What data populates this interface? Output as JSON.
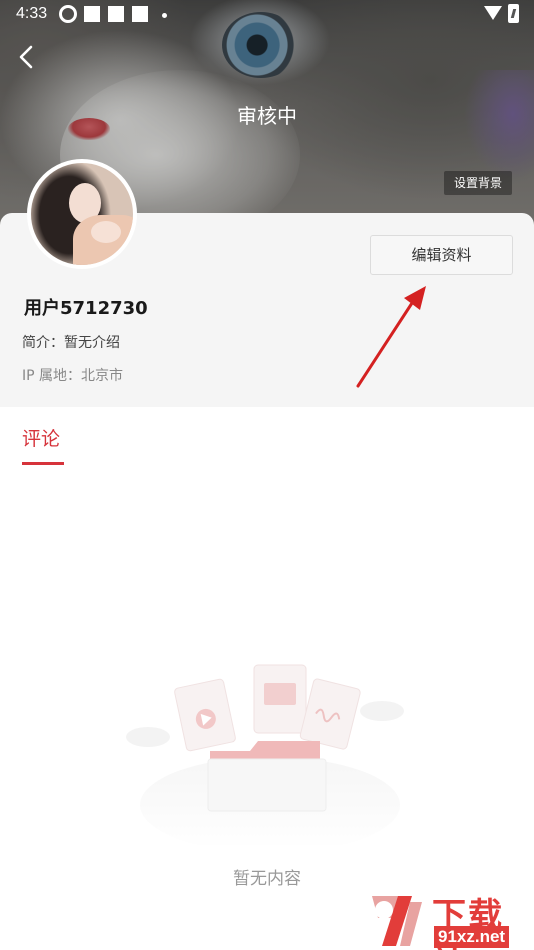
{
  "status_bar": {
    "time": "4:33"
  },
  "header": {
    "title": "审核中",
    "set_background_label": "设置背景",
    "icons": {
      "back": "back-chevron-icon"
    }
  },
  "profile": {
    "username": "用户5712730",
    "bio": "简介：暂无介绍",
    "ip_location": "IP 属地：北京市",
    "edit_button_label": "编辑资料"
  },
  "tabs": [
    {
      "label": "评论",
      "active": true
    }
  ],
  "empty_state": {
    "text": "暂无内容"
  },
  "watermark": {
    "top_text": "下载站",
    "bottom_text": "91xz.net"
  },
  "colors": {
    "accent": "#d6333b",
    "card_background": "#f5f5f5",
    "annotation_arrow": "#d42121"
  }
}
